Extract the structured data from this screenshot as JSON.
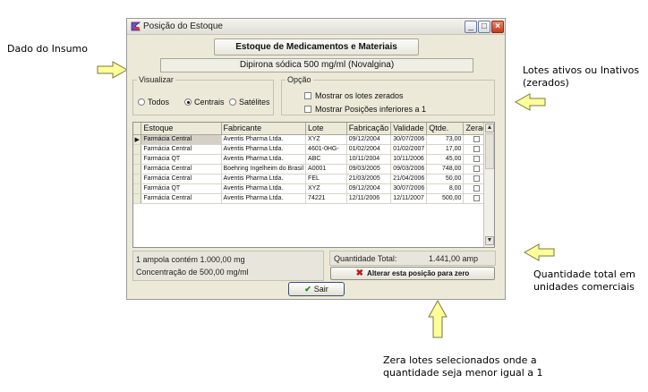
{
  "annotations": {
    "dado_insumo": "Dado do Insumo",
    "lotes_line1": "Lotes ativos ou Inativos",
    "lotes_line2": "(zerados)",
    "quantidade_line1": "Quantidade total em",
    "quantidade_line2": "unidades comerciais",
    "zera_line1": "Zera lotes selecionados onde a",
    "zera_line2": "quantidade seja menor igual a 1"
  },
  "window": {
    "title": "Posição do Estoque",
    "header_button": "Estoque de Medicamentos e Materiais",
    "product": "Dipirona sódica 500 mg/ml (Novalgina)"
  },
  "visualizar": {
    "legend": "Visualizar",
    "options": [
      "Todos",
      "Centrais",
      "Satélites"
    ],
    "selected": "Centrais"
  },
  "opcao": {
    "legend": "Opção",
    "check1": "Mostrar os lotes zerados",
    "check2": "Mostrar Posições inferiores a 1"
  },
  "table": {
    "columns": [
      "Estoque",
      "Fabricante",
      "Lote",
      "Fabricação",
      "Validade",
      "Qtde.",
      "Zerado"
    ],
    "rows": [
      [
        "Farmácia Central",
        "Aventis Pharma Ltda.",
        "XYZ",
        "09/12/2004",
        "30/07/2006",
        "73,00"
      ],
      [
        "Farmácia Central",
        "Aventis Pharma Ltda.",
        "4601-0HG-",
        "01/02/2004",
        "01/02/2007",
        "17,00"
      ],
      [
        "Farmácia QT",
        "Aventis Pharma Ltda.",
        "ABC",
        "10/11/2004",
        "10/11/2006",
        "45,00"
      ],
      [
        "Farmácia Central",
        "Boehring Ingelheim do Brasil",
        "A0001",
        "09/03/2005",
        "09/03/2006",
        "748,00"
      ],
      [
        "Farmácia Central",
        "Aventis Pharma Ltda.",
        "FEL",
        "21/03/2005",
        "21/04/2006",
        "50,00"
      ],
      [
        "Farmácia QT",
        "Aventis Pharma Ltda.",
        "XYZ",
        "09/12/2004",
        "30/07/2006",
        "8,00"
      ],
      [
        "Farmácia Central",
        "Aventis Pharma Ltda.",
        "74221",
        "12/11/2006",
        "12/11/2007",
        "500,00"
      ]
    ]
  },
  "footer": {
    "ampola": "1 ampola contém 1.000,00 mg",
    "concentracao": "Concentração de 500,00 mg/ml",
    "qty_label": "Quantidade Total:",
    "qty_value": "1.441,00 amp",
    "zero_button": "Alterar esta posição para zero",
    "sair_button": "Sair"
  }
}
